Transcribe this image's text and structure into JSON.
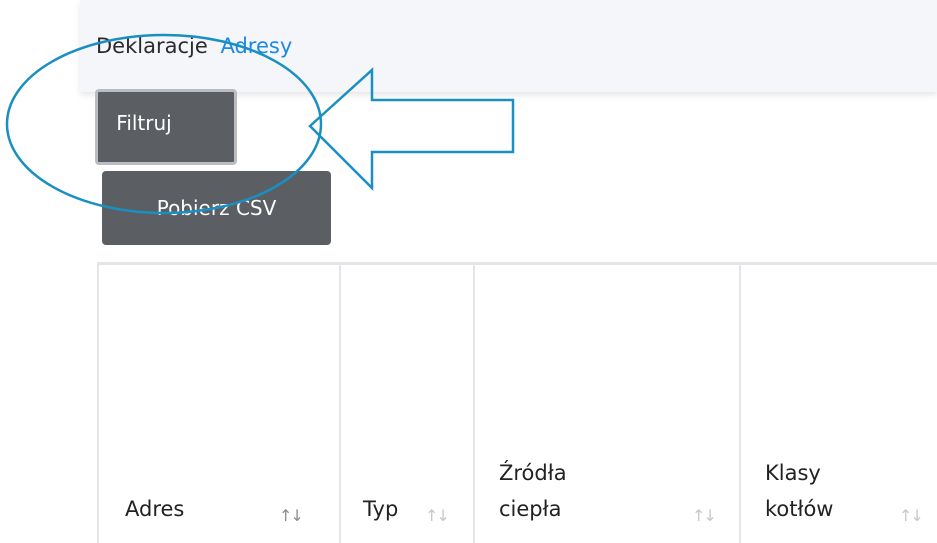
{
  "breadcrumb": {
    "items": [
      "Deklaracje",
      "Adresy"
    ]
  },
  "buttons": {
    "filter_label": "Filtruj",
    "csv_label": "Pobierz CSV"
  },
  "table": {
    "columns": [
      {
        "line1": "",
        "line2": "Adres"
      },
      {
        "line1": "",
        "line2": "Typ"
      },
      {
        "line1": "Źródła",
        "line2": "ciepła"
      },
      {
        "line1": "Klasy",
        "line2": "kotłów"
      }
    ],
    "sort_glyph": "↑↓"
  },
  "colors": {
    "button_bg": "#5b5f63",
    "link": "#1e88e5",
    "annotation": "#1a8fc1"
  }
}
